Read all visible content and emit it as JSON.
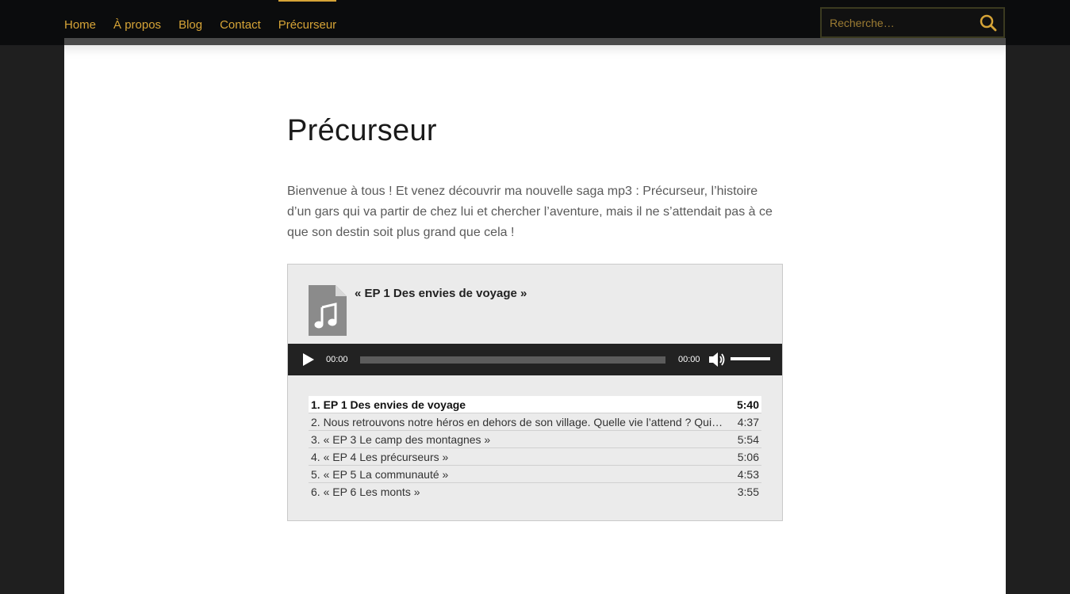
{
  "nav": {
    "items": [
      {
        "label": "Home"
      },
      {
        "label": "À propos"
      },
      {
        "label": "Blog"
      },
      {
        "label": "Contact"
      },
      {
        "label": "Précurseur"
      }
    ],
    "active_index": 4
  },
  "search": {
    "placeholder": "Recherche…"
  },
  "page": {
    "title": "Précurseur",
    "intro": "Bienvenue à tous ! Et venez découvrir ma nouvelle saga mp3 : Précurseur, l’histoire d’un gars qui va partir de chez lui et chercher l’aventure, mais il ne s’attendait pas à ce que son destin soit plus grand que cela !"
  },
  "playlist": {
    "current_title": "« EP 1 Des envies de voyage »",
    "current_time": "00:00",
    "duration": "00:00",
    "tracks": [
      {
        "label": "1. EP 1 Des envies de voyage",
        "duration": "5:40"
      },
      {
        "label": "2. Nous retrouvons notre héros en dehors de son village. Quelle vie l’attend ? Qui…",
        "duration": "4:37"
      },
      {
        "label": "3. « EP 3 Le camp des montagnes »",
        "duration": "5:54"
      },
      {
        "label": "4. « EP 4 Les précurseurs »",
        "duration": "5:06"
      },
      {
        "label": "5. « EP 5 La communauté »",
        "duration": "4:53"
      },
      {
        "label": "6. « EP 6 Les monts »",
        "duration": "3:55"
      }
    ]
  },
  "colors": {
    "accent": "#d6a437",
    "topbar": "#0b0c0d",
    "player_bg": "#222222"
  }
}
